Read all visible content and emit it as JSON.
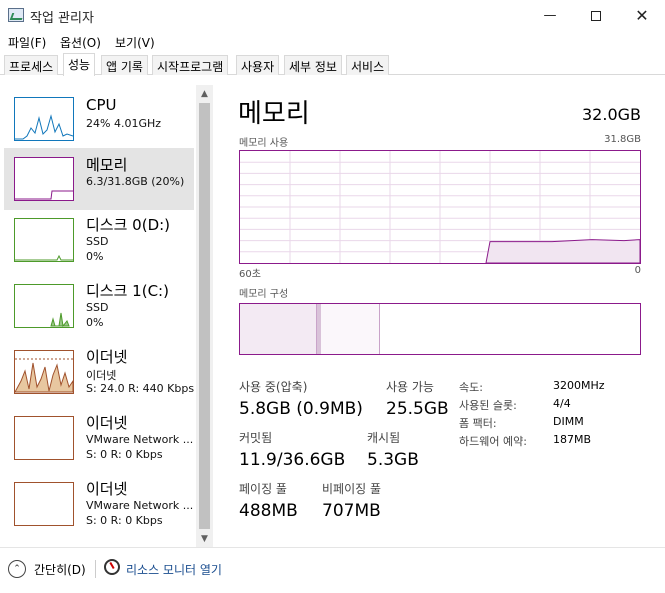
{
  "window": {
    "title": "작업 관리자",
    "controls": [
      "minimize",
      "maximize",
      "close"
    ]
  },
  "menu": [
    "파일(F)",
    "옵션(O)",
    "보기(V)"
  ],
  "tabs": [
    {
      "label": "프로세스"
    },
    {
      "label": "성능",
      "active": true
    },
    {
      "label": "앱 기록"
    },
    {
      "label": "시작프로그램"
    },
    {
      "label": "사용자"
    },
    {
      "label": "세부 정보"
    },
    {
      "label": "서비스"
    }
  ],
  "sidebar": {
    "items": [
      {
        "title": "CPU",
        "sub1": "24%  4.01GHz",
        "sub2": "",
        "color": "#1177bb"
      },
      {
        "title": "메모리",
        "sub1": "6.3/31.8GB (20%)",
        "sub2": "",
        "color": "#8b1a8b",
        "selected": true
      },
      {
        "title": "디스크 0(D:)",
        "sub1": "SSD",
        "sub2": "0%",
        "color": "#4d9a2a"
      },
      {
        "title": "디스크 1(C:)",
        "sub1": "SSD",
        "sub2": "0%",
        "color": "#4d9a2a"
      },
      {
        "title": "이더넷",
        "sub1": "이더넷",
        "sub2": "S: 24.0  R: 440 Kbps",
        "color": "#a0522d"
      },
      {
        "title": "이더넷",
        "sub1": "VMware Network ...",
        "sub2": "S: 0  R: 0 Kbps",
        "color": "#a0522d"
      },
      {
        "title": "이더넷",
        "sub1": "VMware Network ...",
        "sub2": "S: 0  R: 0 Kbps",
        "color": "#a0522d"
      }
    ]
  },
  "main": {
    "title": "메모리",
    "total": "32.0GB",
    "usage_label": "메모리 사용",
    "usage_max": "31.8GB",
    "x_left": "60초",
    "x_right": "0",
    "composition_label": "메모리 구성",
    "usage_graph_fraction": 0.2,
    "stats": {
      "in_use_label": "사용 중(압축)",
      "in_use_value": "5.8GB (0.9MB)",
      "available_label": "사용 가능",
      "available_value": "25.5GB",
      "committed_label": "커밋됨",
      "committed_value": "11.9/36.6GB",
      "cached_label": "캐시됨",
      "cached_value": "5.3GB",
      "paged_label": "페이징 풀",
      "paged_value": "488MB",
      "nonpaged_label": "비페이징 풀",
      "nonpaged_value": "707MB"
    },
    "details": [
      {
        "label": "속도:",
        "value": "3200MHz"
      },
      {
        "label": "사용된 슬롯:",
        "value": "4/4"
      },
      {
        "label": "폼 팩터:",
        "value": "DIMM"
      },
      {
        "label": "하드웨어 예약:",
        "value": "187MB"
      }
    ]
  },
  "footer": {
    "fewer_details": "간단히(D)",
    "open_resmon": "리소스 모니터 열기"
  }
}
